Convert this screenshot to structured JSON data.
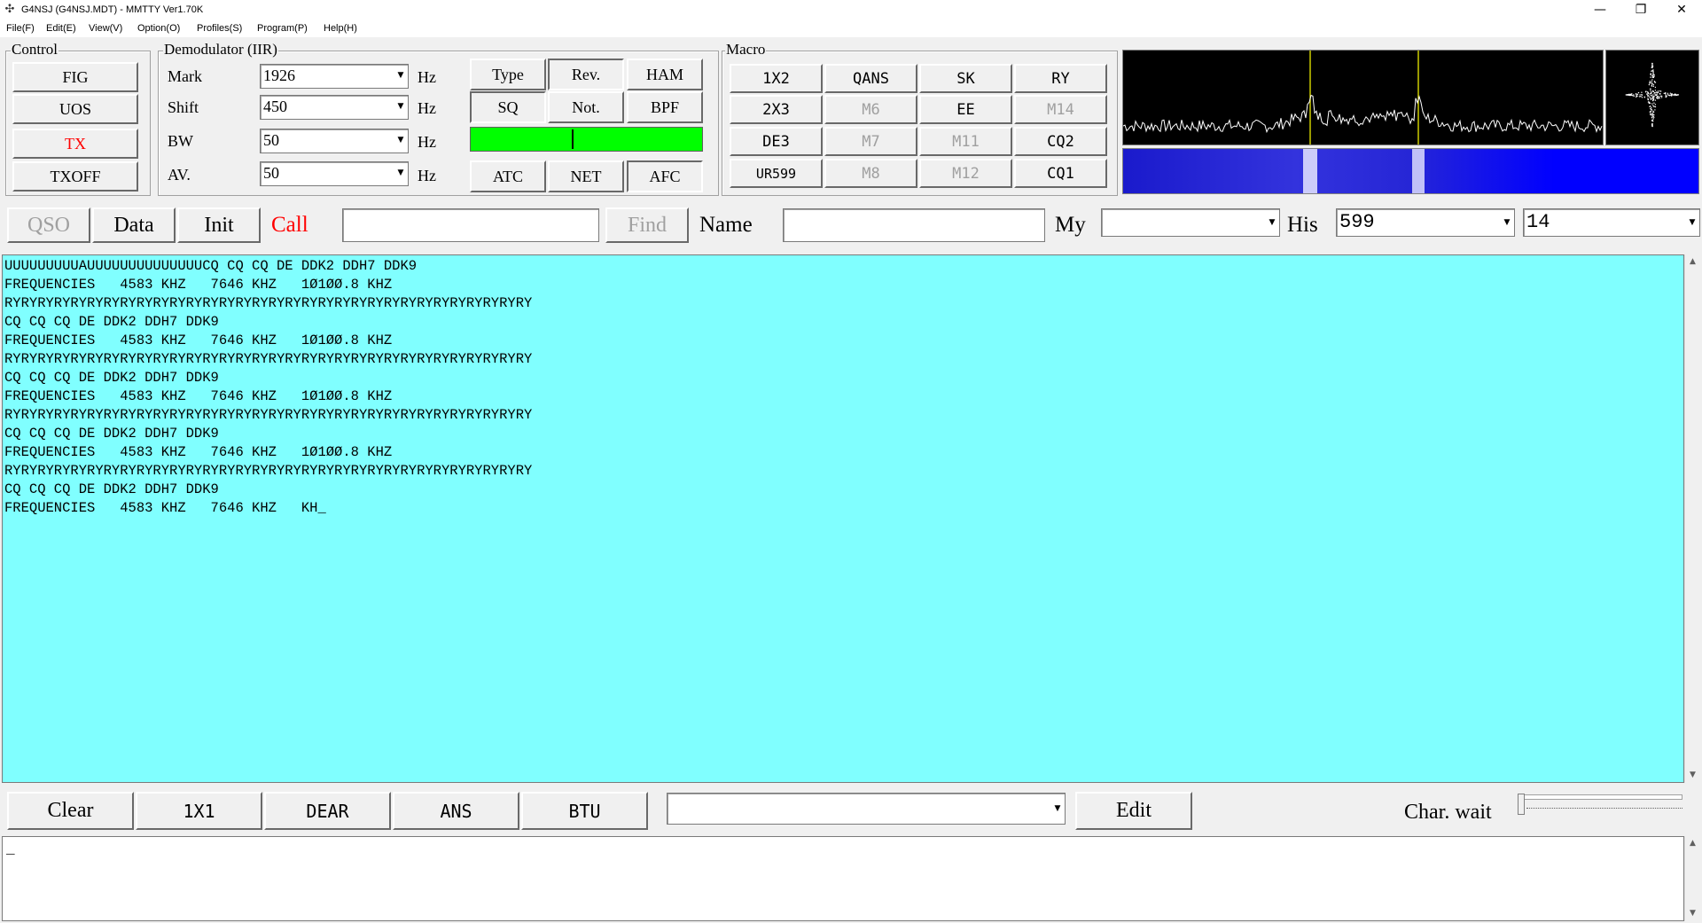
{
  "window": {
    "title": "G4NSJ (G4NSJ.MDT) - MMTTY Ver1.70K",
    "app_icon": "app-icon",
    "minimize_glyph": "—",
    "maximize_glyph": "❐",
    "close_glyph": "✕"
  },
  "menu": [
    "File(F)",
    "Edit(E)",
    "View(V)",
    "Option(O)",
    "Profiles(S)",
    "Program(P)",
    "Help(H)"
  ],
  "control": {
    "title": "Control",
    "buttons": [
      "FIG",
      "UOS",
      "TX",
      "TXOFF"
    ]
  },
  "demodulator": {
    "title": "Demodulator (IIR)",
    "mark": {
      "label": "Mark",
      "value": "1926",
      "unit": "Hz"
    },
    "shift": {
      "label": "Shift",
      "value": "450",
      "unit": "Hz"
    },
    "bw": {
      "label": "BW",
      "value": "50",
      "unit": "Hz"
    },
    "av": {
      "label": "AV.",
      "value": "50",
      "unit": "Hz"
    },
    "buttons": {
      "type": "Type",
      "rev": "Rev.",
      "ham": "HAM",
      "sq": "SQ",
      "not": "Not.",
      "bpf": "BPF",
      "atc": "ATC",
      "net": "NET",
      "afc": "AFC"
    },
    "level_color": "#00ff00"
  },
  "macro": {
    "title": "Macro",
    "rows": [
      [
        "1X2",
        "QANS",
        "SK",
        "RY"
      ],
      [
        "2X3",
        "M6",
        "EE",
        "M14"
      ],
      [
        "DE3",
        "M7",
        "M11",
        "CQ2"
      ],
      [
        "UR599",
        "M8",
        "M12",
        "CQ1"
      ]
    ]
  },
  "qso_bar": {
    "qso": "QSO",
    "data": "Data",
    "init": "Init",
    "call": "Call",
    "call_value": "",
    "find": "Find",
    "name": "Name",
    "name_value": "",
    "my": "My",
    "my_value": "",
    "his": "His",
    "his_value": "599",
    "extra_value": "14"
  },
  "rx_text": [
    "UUUUUUUUUAUUUUUUUUUUUUUUCQ CQ CQ DE DDK2 DDH7 DDK9",
    "FREQUENCIES   4583 KHZ   7646 KHZ   1Ø1ØØ.8 KHZ",
    "RYRYRYRYRYRYRYRYRYRYRYRYRYRYRYRYRYRYRYRYRYRYRYRYRYRYRYRYRYRYRYRY",
    "CQ CQ CQ DE DDK2 DDH7 DDK9",
    "FREQUENCIES   4583 KHZ   7646 KHZ   1Ø1ØØ.8 KHZ",
    "RYRYRYRYRYRYRYRYRYRYRYRYRYRYRYRYRYRYRYRYRYRYRYRYRYRYRYRYRYRYRYRY",
    "CQ CQ CQ DE DDK2 DDH7 DDK9",
    "FREQUENCIES   4583 KHZ   7646 KHZ   1Ø1ØØ.8 KHZ",
    "RYRYRYRYRYRYRYRYRYRYRYRYRYRYRYRYRYRYRYRYRYRYRYRYRYRYRYRYRYRYRYRY",
    "CQ CQ CQ DE DDK2 DDH7 DDK9",
    "FREQUENCIES   4583 KHZ   7646 KHZ   1Ø1ØØ.8 KHZ",
    "RYRYRYRYRYRYRYRYRYRYRYRYRYRYRYRYRYRYRYRYRYRYRYRYRYRYRYRYRYRYRYRY",
    "CQ CQ CQ DE DDK2 DDH7 DDK9",
    "FREQUENCIES   4583 KHZ   7646 KHZ   KH_"
  ],
  "bottom_bar": {
    "clear": "Clear",
    "b1x1": "1X1",
    "dear": "DEAR",
    "ans": "ANS",
    "btu": "BTU",
    "combo_value": "",
    "edit": "Edit",
    "char_wait": "Char. wait"
  },
  "tx_text": "_",
  "colors": {
    "rx_background": "#80ffff",
    "call_label": "#ff0000",
    "tx_button": "#ff0000",
    "spectrum_marker": "#cccc00",
    "waterfall_background": "#0000ff"
  }
}
